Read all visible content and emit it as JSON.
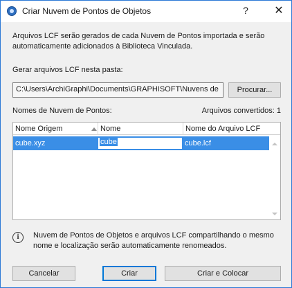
{
  "window": {
    "title": "Criar Nuvem de Pontos de Objetos",
    "help_label": "?",
    "close_label": "✕"
  },
  "description": "Arquivos LCF serão gerados de cada Nuvem de Pontos importada e serão automaticamente adicionados à Biblioteca Vinculada.",
  "folder": {
    "label": "Gerar arquivos LCF nesta pasta:",
    "path": "C:\\Users\\ArchiGraphi\\Documents\\GRAPHISOFT\\Nuvens de",
    "browse_label": "Procurar..."
  },
  "table": {
    "title": "Nomes de Nuvem de Pontos:",
    "converted": "Arquivos convertidos: 1",
    "columns": [
      "Nome Origem",
      "Nome",
      "Nome do Arquivo LCF"
    ],
    "rows": [
      {
        "origin": "cube.xyz",
        "name": "cube",
        "lcf": "cube.lcf"
      }
    ]
  },
  "info": {
    "icon": "info-icon",
    "text": "Nuvem de Pontos de Objetos e arquivos LCF compartilhando o mesmo nome e localização serão automaticamente renomeados."
  },
  "buttons": {
    "cancel": "Cancelar",
    "create": "Criar",
    "create_place": "Criar e Colocar"
  },
  "colors": {
    "selection": "#3a8ee6",
    "window_border": "#2b79d6",
    "default_button_border": "#0078d7"
  }
}
